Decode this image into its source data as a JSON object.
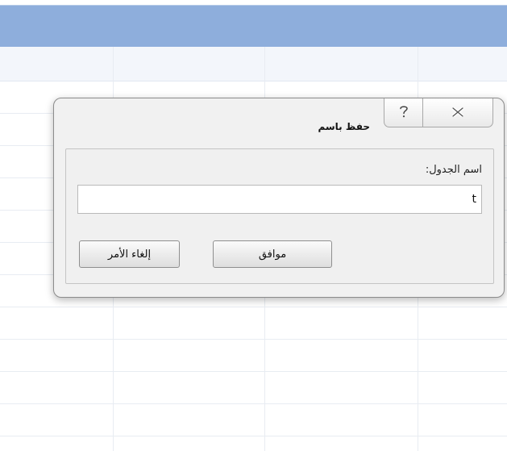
{
  "dialog": {
    "title": "حفظ باسم",
    "help_icon": "help-icon",
    "close_icon": "close-icon",
    "field_label": "اسم الجدول:",
    "table_name_value": "t",
    "ok_label": "موافق",
    "cancel_label": "إلغاء الأمر"
  },
  "colors": {
    "title_bar_blue": "#8eaedc",
    "dialog_background": "#f1f1f1"
  }
}
